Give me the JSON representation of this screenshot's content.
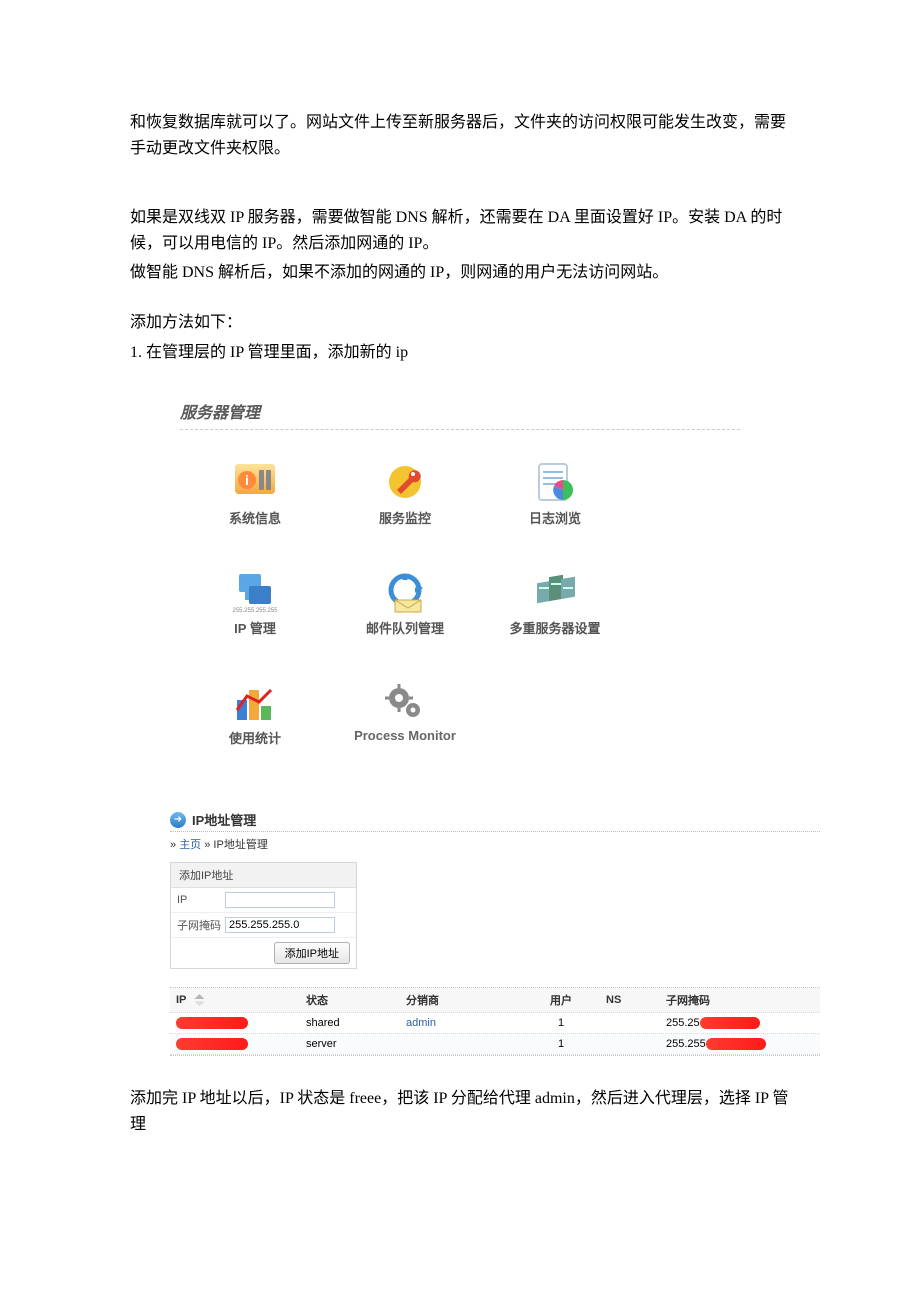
{
  "paragraphs": {
    "p1": "和恢复数据库就可以了。网站文件上传至新服务器后，文件夹的访问权限可能发生改变，需要手动更改文件夹权限。",
    "p2": "如果是双线双 IP 服务器，需要做智能 DNS 解析，还需要在 DA 里面设置好 IP。安装 DA 的时候，可以用电信的 IP。然后添加网通的 IP。",
    "p3": "做智能 DNS 解析后，如果不添加的网通的 IP，则网通的用户无法访问网站。",
    "p4": "添加方法如下：",
    "p5": "1.  在管理层的 IP 管理里面，添加新的 ip",
    "p6": "添加完 IP 地址以后，IP 状态是 freee，把该 IP 分配给代理 admin，然后进入代理层，选择 IP 管理"
  },
  "server_panel": {
    "title": "服务器管理",
    "items": [
      {
        "label": "系统信息",
        "icon": "info"
      },
      {
        "label": "服务监控",
        "icon": "wrench"
      },
      {
        "label": "日志浏览",
        "icon": "log"
      },
      {
        "label": "IP 管理",
        "icon": "ip"
      },
      {
        "label": "邮件队列管理",
        "icon": "mail"
      },
      {
        "label": "多重服务器设置",
        "icon": "servers"
      },
      {
        "label": "使用统计",
        "icon": "stats"
      },
      {
        "label": "Process Monitor",
        "icon": "gears"
      }
    ]
  },
  "ip_panel": {
    "title": "IP地址管理",
    "crumb_sep": " » ",
    "crumb_home": "主页",
    "crumb_here": "IP地址管理",
    "form": {
      "title": "添加IP地址",
      "ip_label": "IP",
      "ip_value": "",
      "mask_label": "子网掩码",
      "mask_value": "255.255.255.0",
      "submit": "添加IP地址"
    },
    "table": {
      "headers": {
        "ip": "IP",
        "status": "状态",
        "reseller": "分销商",
        "user": "用户",
        "ns": "NS",
        "mask": "子网掩码"
      },
      "rows": [
        {
          "status": "shared",
          "reseller": "admin",
          "user": "1",
          "ns": "",
          "mask_prefix": "255.25"
        },
        {
          "status": "server",
          "reseller": "",
          "user": "1",
          "ns": "",
          "mask_prefix": "255.255"
        }
      ]
    }
  }
}
